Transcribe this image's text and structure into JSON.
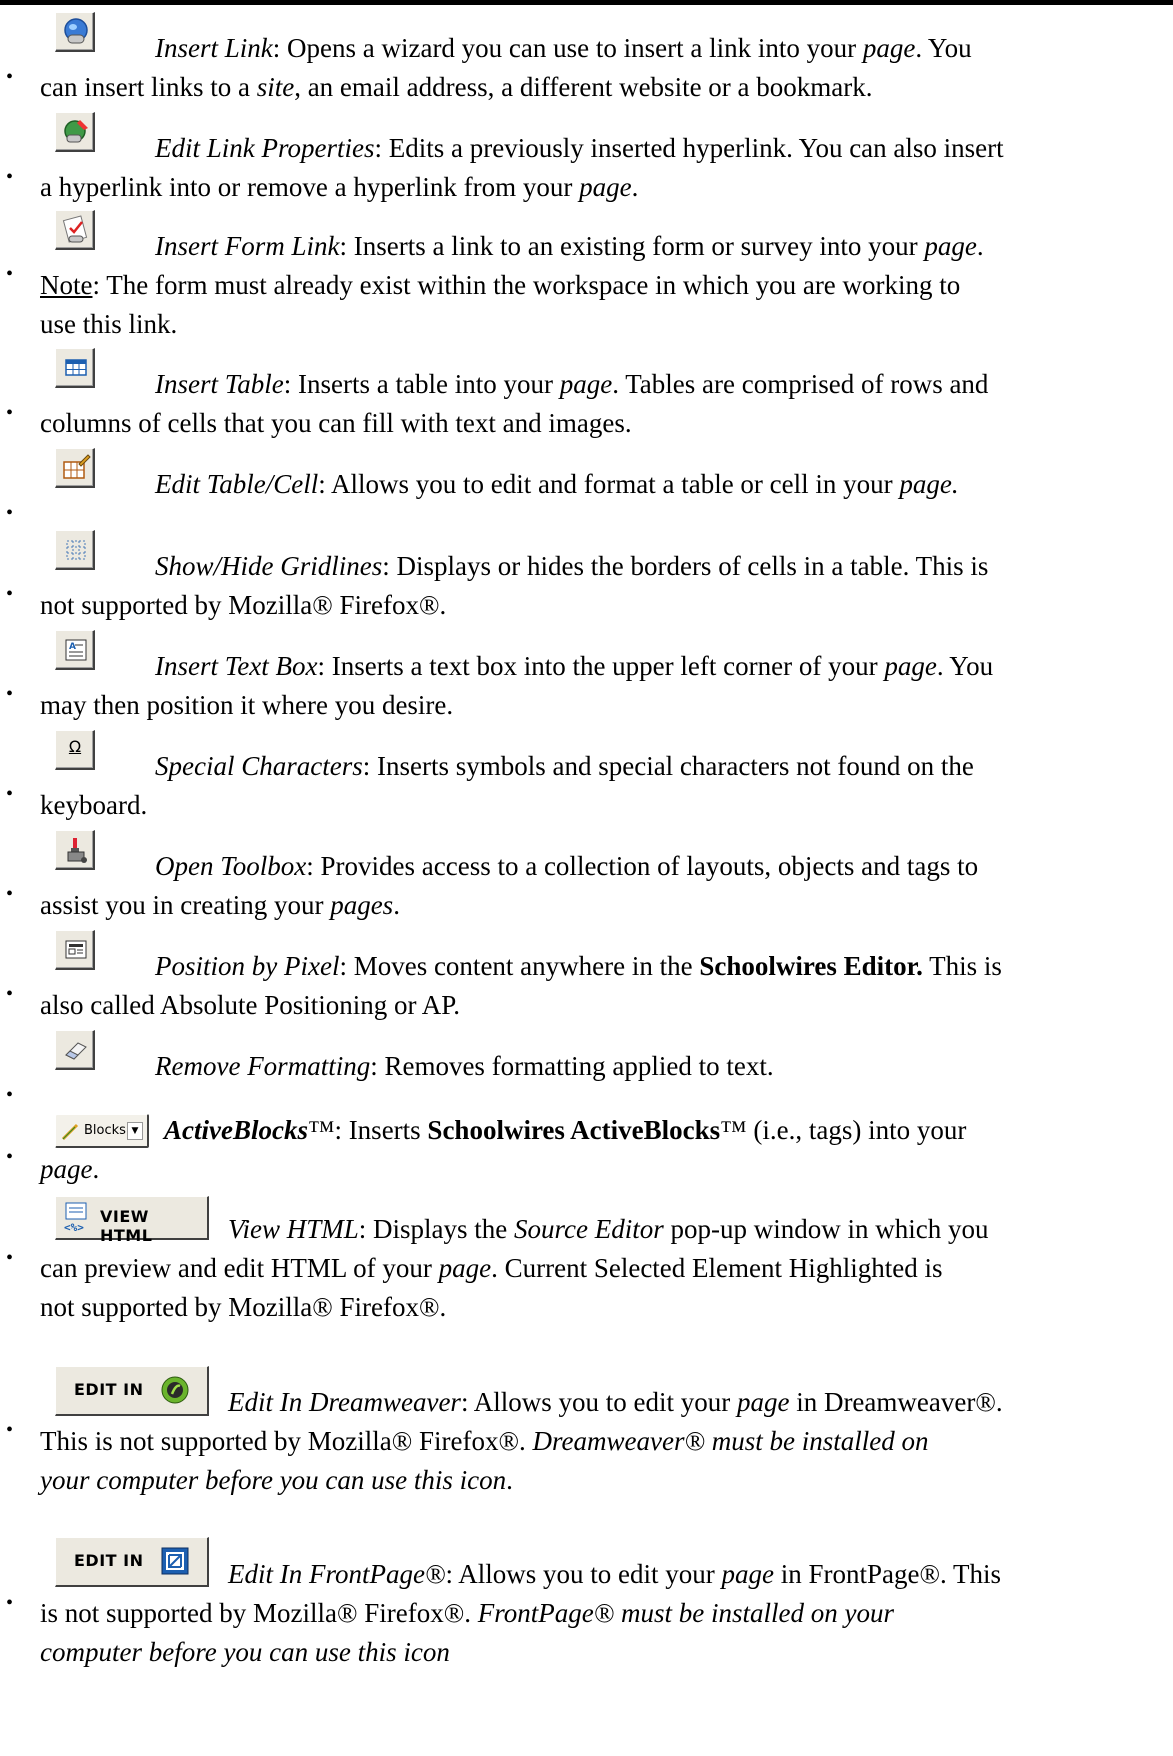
{
  "items": [
    {
      "icon": "insert-link-icon",
      "title": "Insert Link",
      "line1": ": Opens a wizard you can use to insert a link into your ",
      "page": "page",
      "line1_end": ". You",
      "line2a": "can insert links to a ",
      "site": "site",
      "line2b": ", an email address, a different website or a bookmark."
    },
    {
      "icon": "edit-link-icon",
      "title": "Edit Link Properties",
      "line1": ": Edits a previously inserted hyperlink. You can also insert",
      "line2a": "a hyperlink into or remove a hyperlink from your ",
      "page": "page",
      "line2b": "."
    },
    {
      "icon": "insert-form-link-icon",
      "title": "Insert Form Link",
      "line1": ": Inserts a link to an existing form or survey into your ",
      "page": "page",
      "line1_end": ".",
      "note": "Note",
      "line2": ": The form must already exist within the workspace in which you are working to",
      "line3": "use this link."
    },
    {
      "icon": "insert-table-icon",
      "title": "Insert Table",
      "line1": ": Inserts a table into your ",
      "page": "page",
      "line1_end": ". Tables are comprised of rows and",
      "line2": "columns of cells that you can fill with text and images."
    },
    {
      "icon": "edit-table-icon",
      "title": "Edit Table/Cell",
      "line1": ": Allows you to edit and format a table or cell in your ",
      "page": "page.",
      "line1_end": ""
    },
    {
      "icon": "gridlines-icon",
      "title": "Show/Hide Gridlines",
      "line1": ": Displays or hides the borders of cells in a table. This is",
      "line2": "not supported by Mozilla® Firefox®."
    },
    {
      "icon": "text-box-icon",
      "title": "Insert Text Box",
      "line1": ": Inserts a text box into the upper left corner of your ",
      "page": "page",
      "line1_end": ". You",
      "line2": "may then position it where you desire."
    },
    {
      "icon": "omega-icon",
      "icon_char": "Ω",
      "title": "Special Characters",
      "line1": ": Inserts symbols and special characters not found on the",
      "line2": "keyboard."
    },
    {
      "icon": "toolbox-icon",
      "title": "Open Toolbox",
      "line1": ": Provides access to a collection of layouts, objects and tags to",
      "line2a": "assist you in creating your ",
      "pages": "pages",
      "line2b": "."
    },
    {
      "icon": "position-pixel-icon",
      "title": "Position by Pixel",
      "line1": ": Moves content anywhere in the ",
      "bold": "Schoolwires Editor.",
      "line1_end": " This is",
      "line2": "also called Absolute Positioning or AP."
    },
    {
      "icon": "eraser-icon",
      "title": "Remove Formatting",
      "line1": ": Removes formatting applied to text."
    },
    {
      "icon": "blocks-icon",
      "button_label": "Blocks",
      "title": "ActiveBlocks",
      "tm": "™",
      "line1": ": Inserts ",
      "bold": "Schoolwires ActiveBlocks",
      "line1_end": "™ (i.e., tags) into your",
      "page": "page",
      "line2_end": "."
    },
    {
      "icon": "view-html-icon",
      "button_label": "VIEW HTML",
      "title": "View HTML",
      "line1": ": Displays the ",
      "source_editor": "Source Editor",
      "line1_end": " pop-up window in which you",
      "line2a": "can preview and edit HTML of your ",
      "page": "page",
      "line2b": ". Current Selected Element Highlighted is",
      "line3": "not supported by Mozilla® Firefox®."
    },
    {
      "icon": "dreamweaver-icon",
      "button_label": "EDIT IN",
      "title": "Edit In Dreamweaver",
      "line1": ": Allows you to edit your ",
      "page": "page",
      "line1_end": " in Dreamweaver®.",
      "line2a": "This is not supported by Mozilla® Firefox®. ",
      "line2_italic": "Dreamweaver® must be installed on",
      "line3_italic": "your computer before you can use this icon",
      "line3_end": "."
    },
    {
      "icon": "frontpage-icon",
      "button_label": "EDIT IN",
      "title": "Edit In FrontPage®",
      "line1": ": Allows you to edit your ",
      "page": "page",
      "line1_end": " in FrontPage®. This",
      "line2a": "is not supported by Mozilla® Firefox®. ",
      "line2_italic": "FrontPage® must be installed on your",
      "line3_italic": "computer before you can use this icon"
    }
  ],
  "colors": {
    "text": "#000000",
    "button_face": "#ece9e0"
  }
}
